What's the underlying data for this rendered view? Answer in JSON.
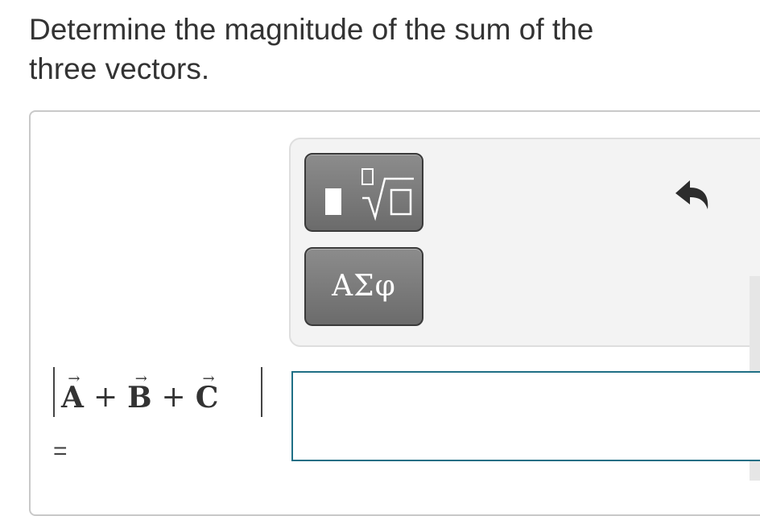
{
  "question": {
    "line1": "Determine the magnitude of the sum of the",
    "line2": "three vectors."
  },
  "toolbar": {
    "templates_icon": "fraction-root-template-icon",
    "greek_label": "ΑΣφ",
    "undo_icon": "undo-arrow-icon"
  },
  "formula": {
    "vector_a": "A",
    "vector_b": "B",
    "vector_c": "C",
    "plus": "+",
    "arrow": "→",
    "equals": "="
  },
  "answer": {
    "value": ""
  },
  "colors": {
    "input_border": "#1f6f85",
    "button_fill": "#7a7a7a",
    "panel_bg": "#f3f3f3"
  }
}
